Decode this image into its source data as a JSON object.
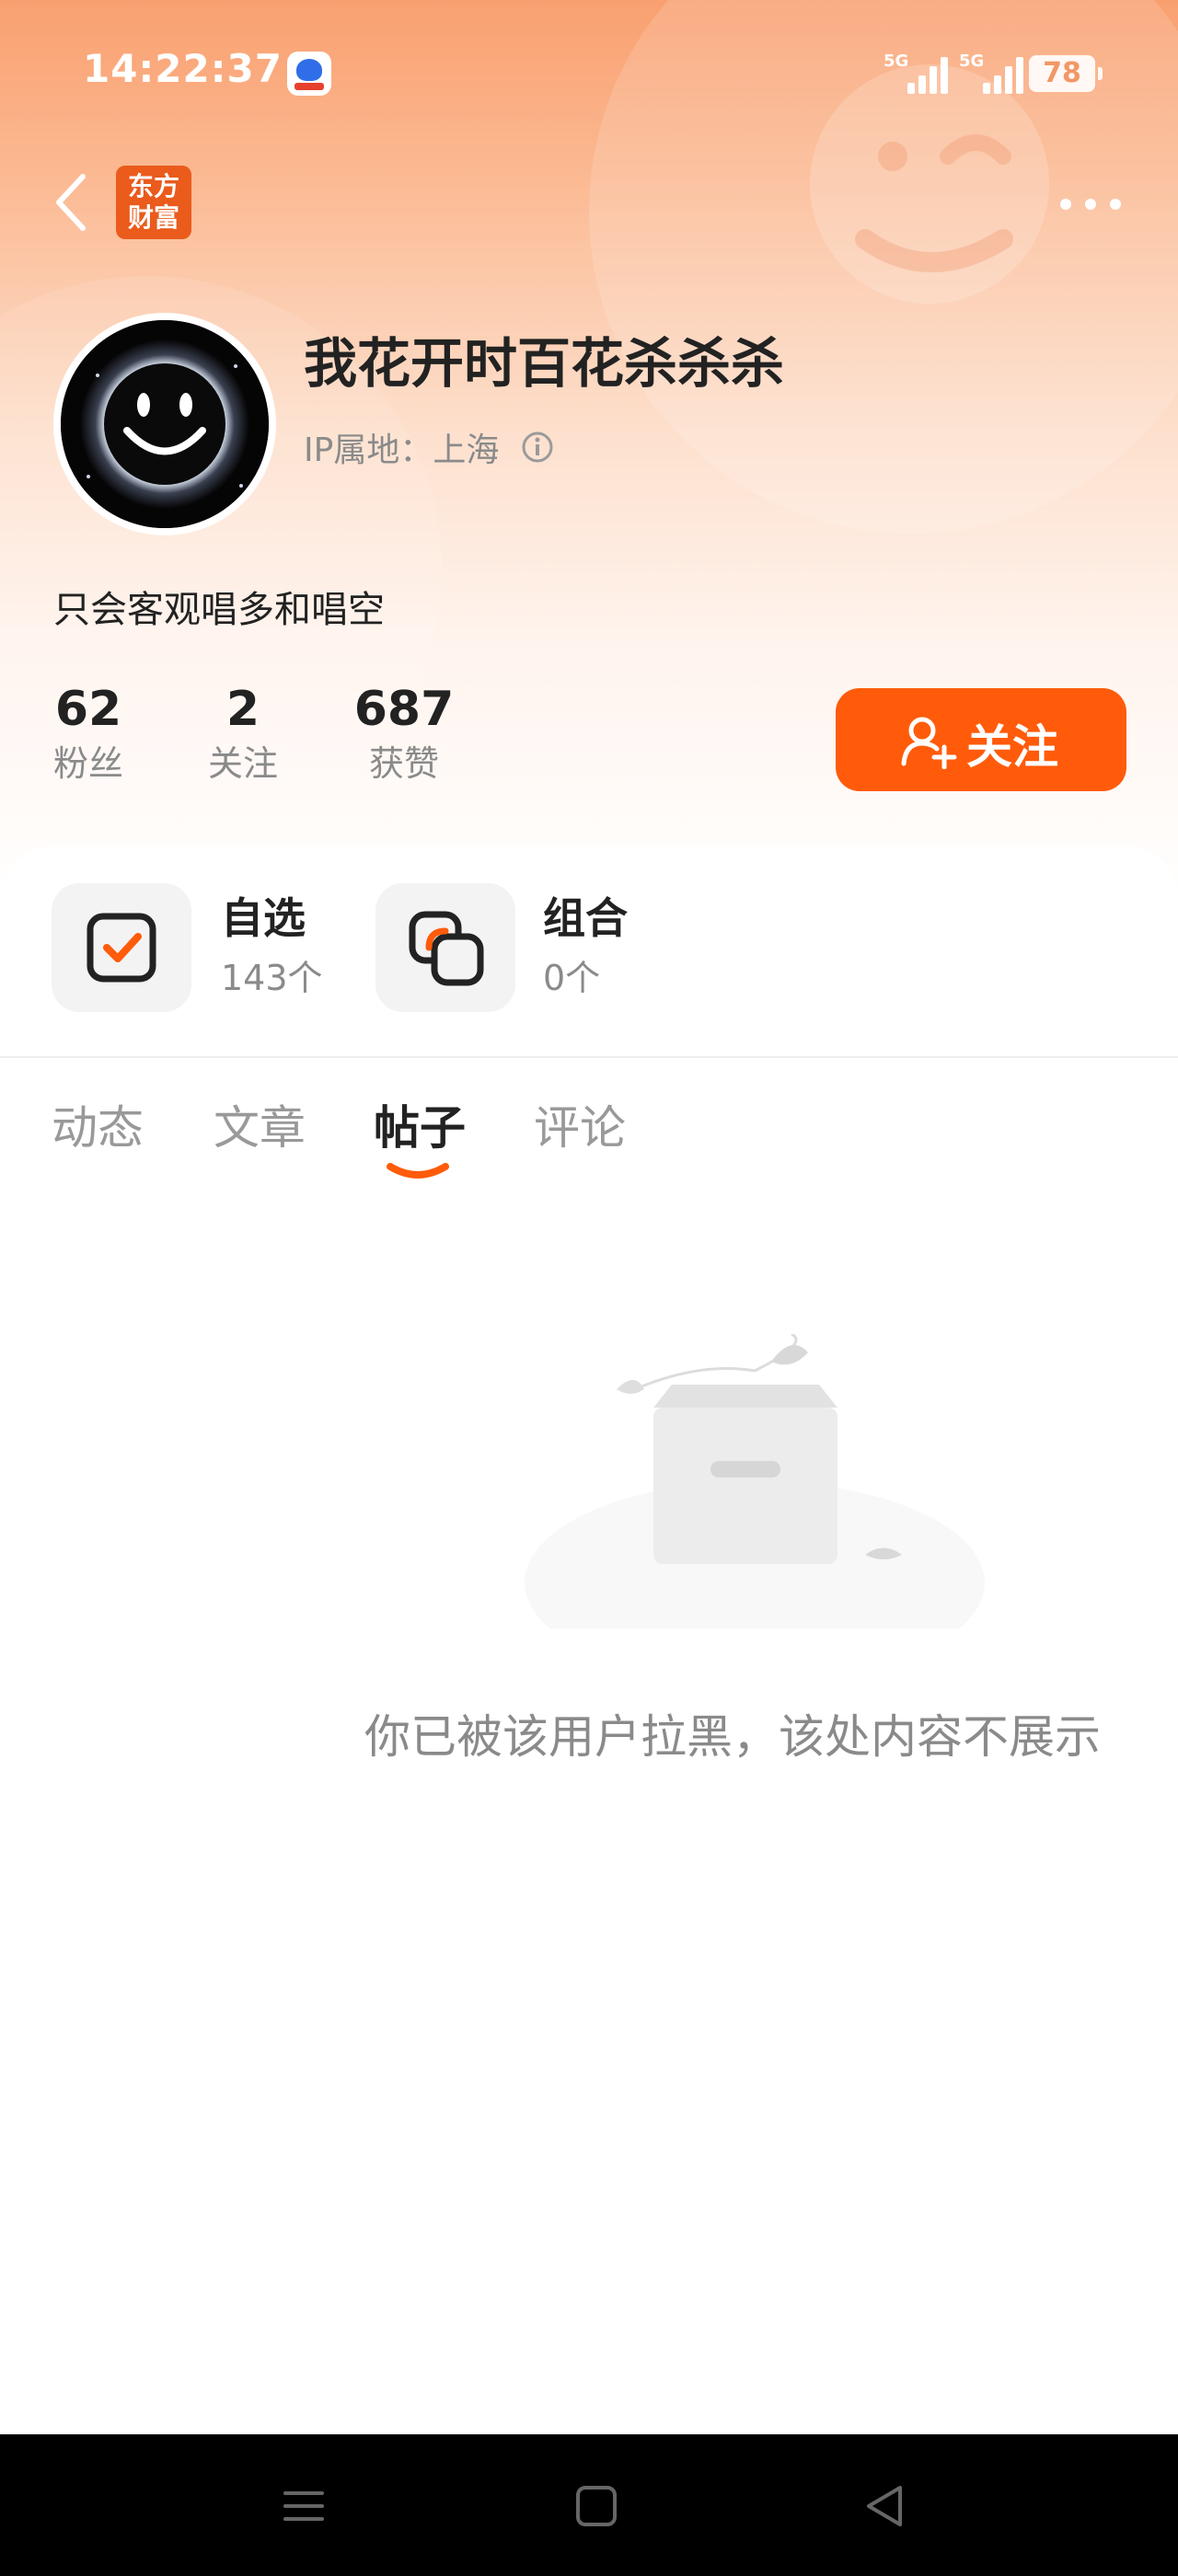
{
  "status_bar": {
    "time": "14:22:37",
    "signal_1_label": "5G",
    "signal_2_label": "5G",
    "battery": "78"
  },
  "header": {
    "logo_line1": "东方",
    "logo_line2": "财富",
    "accent_color": "#ff5b0a"
  },
  "profile": {
    "username": "我花开时百花杀杀杀",
    "ip_location": "IP属地：上海",
    "bio": "只会客观唱多和唱空",
    "stats": [
      {
        "value": "62",
        "label": "粉丝"
      },
      {
        "value": "2",
        "label": "关注"
      },
      {
        "value": "687",
        "label": "获赞"
      }
    ],
    "follow_button": "关注"
  },
  "favorites": [
    {
      "title": "自选",
      "count": "143个",
      "icon": "watchlist-icon"
    },
    {
      "title": "组合",
      "count": "0个",
      "icon": "portfolio-icon"
    }
  ],
  "tabs": [
    {
      "label": "动态",
      "active": false
    },
    {
      "label": "文章",
      "active": false
    },
    {
      "label": "帖子",
      "active": true
    },
    {
      "label": "评论",
      "active": false
    }
  ],
  "empty_state": {
    "message": "你已被该用户拉黑，该处内容不展示",
    "icon": "empty-box-icon"
  },
  "nav_bar": [
    "menu-icon",
    "home-icon",
    "back-triangle-icon"
  ]
}
